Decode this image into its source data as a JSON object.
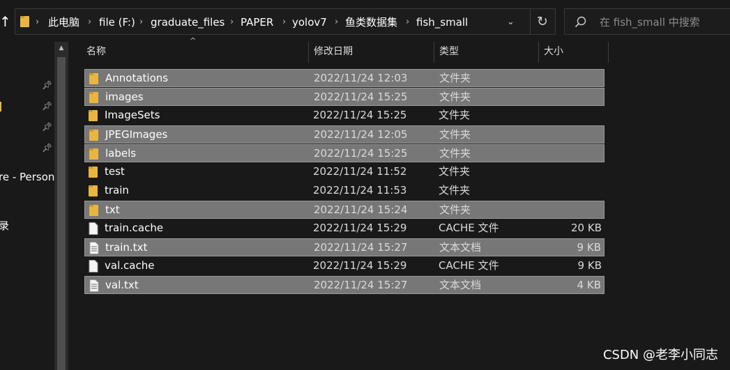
{
  "address": {
    "crumbs": [
      "此电脑",
      "file (F:)",
      "graduate_files",
      "PAPER",
      "yolov7",
      "鱼类数据集",
      "fish_small"
    ]
  },
  "search": {
    "placeholder": "在 fish_small 中搜索"
  },
  "nav": {
    "onedrive_label": "re - Persona",
    "recycle_label": "录"
  },
  "columns": {
    "name": "名称",
    "date": "修改日期",
    "type": "类型",
    "size": "大小"
  },
  "files": [
    {
      "name": "Annotations",
      "date": "2022/11/24 12:03",
      "type": "文件夹",
      "size": "",
      "kind": "folder",
      "selected": true
    },
    {
      "name": "images",
      "date": "2022/11/24 15:25",
      "type": "文件夹",
      "size": "",
      "kind": "folder",
      "selected": true
    },
    {
      "name": "ImageSets",
      "date": "2022/11/24 15:25",
      "type": "文件夹",
      "size": "",
      "kind": "folder",
      "selected": false
    },
    {
      "name": "JPEGImages",
      "date": "2022/11/24 12:05",
      "type": "文件夹",
      "size": "",
      "kind": "folder",
      "selected": true
    },
    {
      "name": "labels",
      "date": "2022/11/24 15:25",
      "type": "文件夹",
      "size": "",
      "kind": "folder",
      "selected": true
    },
    {
      "name": "test",
      "date": "2022/11/24 11:52",
      "type": "文件夹",
      "size": "",
      "kind": "folder",
      "selected": false
    },
    {
      "name": "train",
      "date": "2022/11/24 11:53",
      "type": "文件夹",
      "size": "",
      "kind": "folder",
      "selected": false
    },
    {
      "name": "txt",
      "date": "2022/11/24 15:24",
      "type": "文件夹",
      "size": "",
      "kind": "folder",
      "selected": true
    },
    {
      "name": "train.cache",
      "date": "2022/11/24 15:29",
      "type": "CACHE 文件",
      "size": "20 KB",
      "kind": "file",
      "selected": false
    },
    {
      "name": "train.txt",
      "date": "2022/11/24 15:27",
      "type": "文本文档",
      "size": "9 KB",
      "kind": "text",
      "selected": true
    },
    {
      "name": "val.cache",
      "date": "2022/11/24 15:29",
      "type": "CACHE 文件",
      "size": "9 KB",
      "kind": "file",
      "selected": false
    },
    {
      "name": "val.txt",
      "date": "2022/11/24 15:27",
      "type": "文本文档",
      "size": "4 KB",
      "kind": "text",
      "selected": true
    }
  ],
  "watermark": "CSDN @老李小同志",
  "colors": {
    "folder": "#e8b640",
    "selection": "#777777",
    "background": "#191919"
  }
}
